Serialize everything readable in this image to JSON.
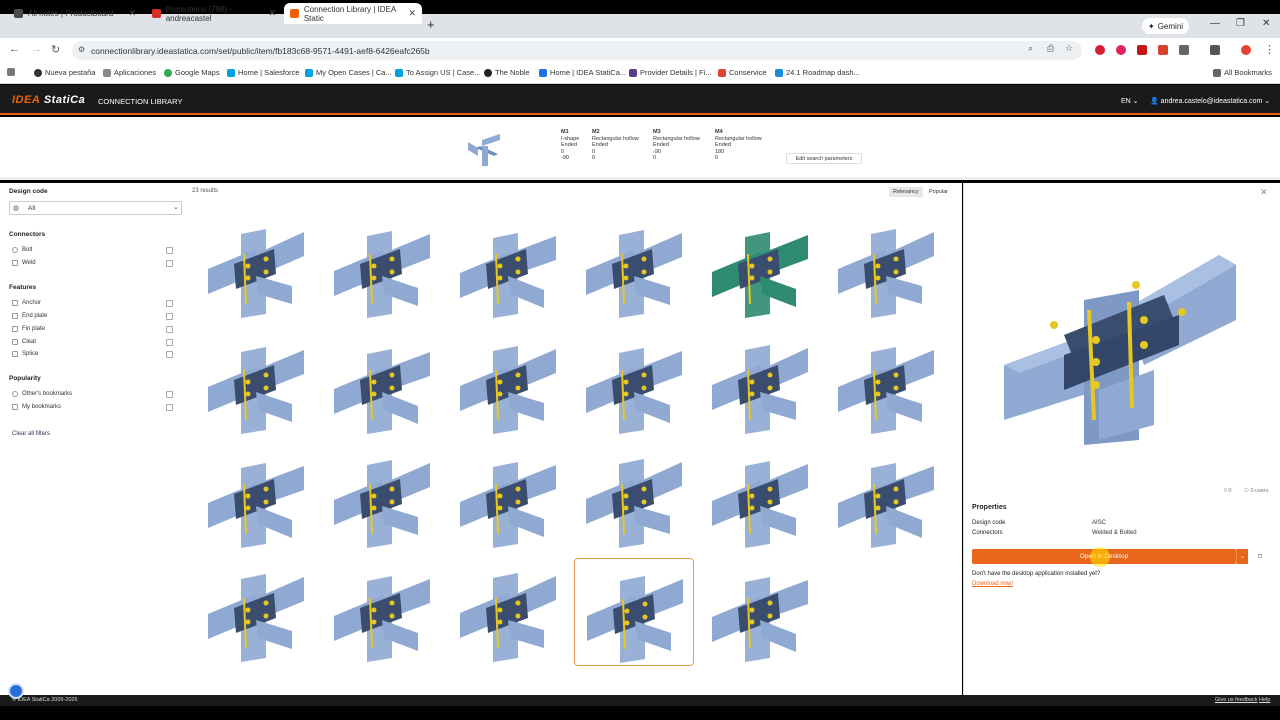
{
  "browser": {
    "tabs": [
      {
        "title": "All notes | Productboard",
        "color": "#4a4a4a"
      },
      {
        "title": "Promotions (798) - andreacastel",
        "color": "#d93025"
      },
      {
        "title": "Connection Library | IDEA Static",
        "color": "#f06000"
      }
    ],
    "gemini_label": "Gemini",
    "url": "connectionlibrary.ideastatica.com/set/public/item/fb183c68-9571-4491-aef8-6426eafc265b",
    "bookmarks": [
      {
        "label": "Nueva pestaña",
        "color": "#333"
      },
      {
        "label": "Aplicaciones",
        "color": "#888"
      },
      {
        "label": "Google Maps",
        "color": "#34a853"
      },
      {
        "label": "Home | Salesforce",
        "color": "#00a1e0"
      },
      {
        "label": "My Open Cases | Ca...",
        "color": "#00a1e0"
      },
      {
        "label": "To Assign US | Case...",
        "color": "#00a1e0"
      },
      {
        "label": "The Noble",
        "color": "#222"
      },
      {
        "label": "Home | IDEA StatiCa...",
        "color": "#1a73e8"
      },
      {
        "label": "Provider Details | Fi...",
        "color": "#5a3e8a"
      },
      {
        "label": "Conservice",
        "color": "#e0403a"
      },
      {
        "label": "24.1 Roadmap dash...",
        "color": "#1a8ad6"
      }
    ],
    "all_bookmarks": "All Bookmarks"
  },
  "header": {
    "logo_prefix": "IDEA",
    "logo_suffix": "StatiCa",
    "title": "CONNECTION LIBRARY",
    "language": "EN",
    "user": "andrea.castelo@ideastatica.com"
  },
  "params": {
    "members": [
      {
        "name": "M1",
        "lines": [
          "I-shape",
          "Ended",
          "0",
          "-90"
        ]
      },
      {
        "name": "M2",
        "lines": [
          "Rectangular hollow",
          "Ended",
          "0",
          "0"
        ]
      },
      {
        "name": "M3",
        "lines": [
          "Rectangular hollow",
          "Ended",
          "-90",
          "0"
        ]
      },
      {
        "name": "M4",
        "lines": [
          "Rectangular hollow",
          "Ended",
          "180",
          "0"
        ]
      }
    ],
    "edit_label": "Edit search parameters"
  },
  "sidebar": {
    "design_code_heading": "Design code",
    "design_code_value": "All",
    "connectors_heading": "Connectors",
    "connectors": [
      "Bolt",
      "Weld"
    ],
    "features_heading": "Features",
    "features": [
      "Anchor",
      "End plate",
      "Fin plate",
      "Cleat",
      "Splice"
    ],
    "popularity_heading": "Popularity",
    "popularity": [
      "Other's bookmarks",
      "My bookmarks"
    ],
    "clear_label": "Clear all filters"
  },
  "results": {
    "count": "23 results",
    "sort_relevancy": "Relevancy",
    "sort_popular": "Popular",
    "selected_index": 21
  },
  "detail": {
    "bookmark_count": "0",
    "users_count": "0 users",
    "properties_heading": "Properties",
    "props": [
      {
        "key": "Design code",
        "value": "AISC"
      },
      {
        "key": "Connectors",
        "value": "Welded & Bolted"
      }
    ],
    "open_label": "Open in Desktop",
    "no_app": "Don't have the desktop application installed yet?",
    "download": "Download now!"
  },
  "footer": {
    "copyright": "© IDEA StatiCa 2009-2026",
    "feedback": "Give us feedback",
    "help": "Help"
  },
  "colors": {
    "accent": "#e8661a",
    "steel": "#8fa9d3",
    "steel_dark": "#3b4d6e",
    "weld": "#e6c820",
    "green": "#2e8b72"
  }
}
